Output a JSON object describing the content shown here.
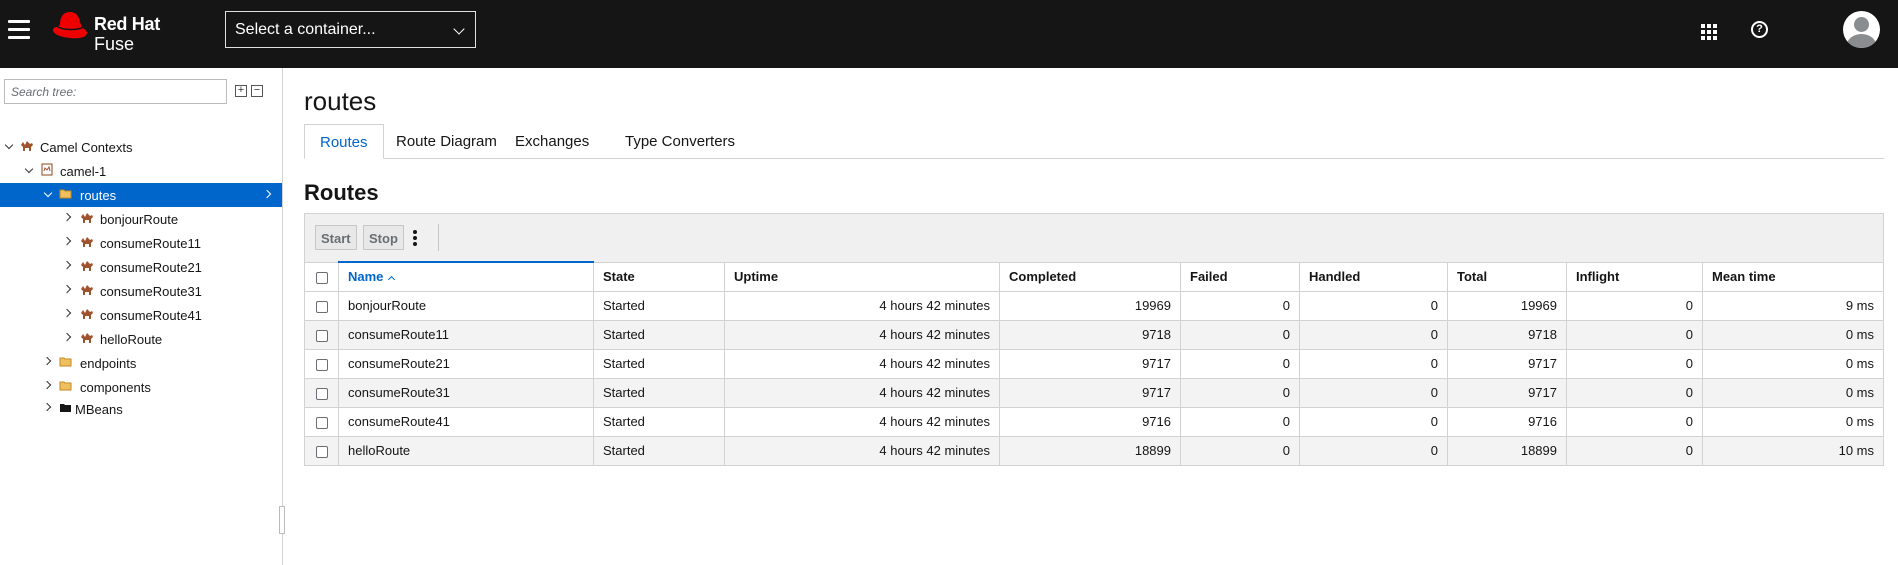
{
  "header": {
    "logo_line1": "Red Hat",
    "logo_line2": "Fuse",
    "container_select": "Select a container...",
    "icons": [
      "menu-icon",
      "apps-grid-icon",
      "help-icon",
      "user-avatar-icon"
    ]
  },
  "sidebar": {
    "search_placeholder": "Search tree:",
    "expand_all": "+",
    "collapse_all": "−",
    "tree": {
      "camel_contexts": "Camel Contexts",
      "camel1": "camel-1",
      "routes": "routes",
      "route_items": [
        "bonjourRoute",
        "consumeRoute11",
        "consumeRoute21",
        "consumeRoute31",
        "consumeRoute41",
        "helloRoute"
      ],
      "endpoints": "endpoints",
      "components": "components",
      "mbeans": "MBeans"
    }
  },
  "main": {
    "title": "routes",
    "tabs": [
      "Routes",
      "Route Diagram",
      "Exchanges",
      "Type Converters"
    ],
    "active_tab": "Routes",
    "section_title": "Routes",
    "toolbar": {
      "start": "Start",
      "stop": "Stop"
    },
    "table": {
      "columns": [
        "Name",
        "State",
        "Uptime",
        "Completed",
        "Failed",
        "Handled",
        "Total",
        "Inflight",
        "Mean time"
      ],
      "rows": [
        [
          "bonjourRoute",
          "Started",
          "4 hours 42 minutes",
          "19969",
          "0",
          "0",
          "19969",
          "0",
          "9 ms"
        ],
        [
          "consumeRoute11",
          "Started",
          "4 hours 42 minutes",
          "9718",
          "0",
          "0",
          "9718",
          "0",
          "0 ms"
        ],
        [
          "consumeRoute21",
          "Started",
          "4 hours 42 minutes",
          "9717",
          "0",
          "0",
          "9717",
          "0",
          "0 ms"
        ],
        [
          "consumeRoute31",
          "Started",
          "4 hours 42 minutes",
          "9717",
          "0",
          "0",
          "9717",
          "0",
          "0 ms"
        ],
        [
          "consumeRoute41",
          "Started",
          "4 hours 42 minutes",
          "9716",
          "0",
          "0",
          "9716",
          "0",
          "0 ms"
        ],
        [
          "helloRoute",
          "Started",
          "4 hours 42 minutes",
          "18899",
          "0",
          "0",
          "18899",
          "0",
          "10 ms"
        ]
      ]
    }
  },
  "colors": {
    "header_bg": "#151515",
    "accent": "#0066cc",
    "brand_red": "#ee0000"
  }
}
